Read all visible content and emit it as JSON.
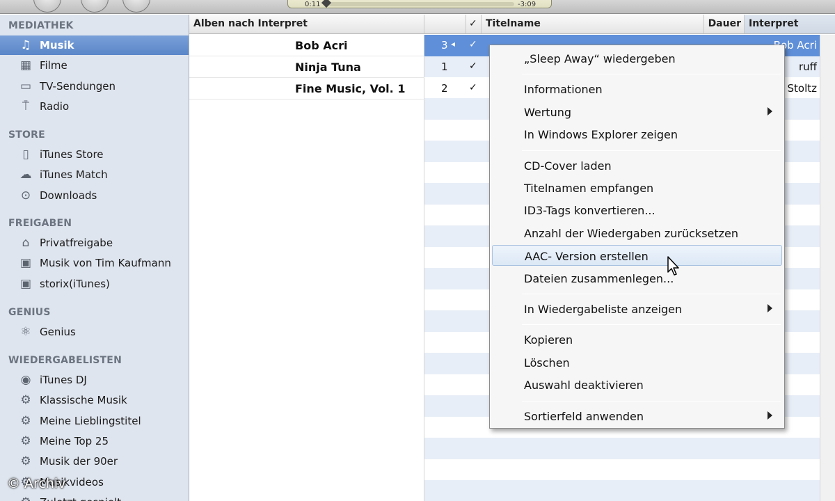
{
  "toolbar": {
    "elapsed": "0:11",
    "remaining": "-3:09"
  },
  "sidebar": {
    "sections": [
      {
        "title": "MEDIATHEK",
        "items": [
          {
            "label": "Musik",
            "icon": "music-note-icon",
            "selected": true
          },
          {
            "label": "Filme",
            "icon": "film-icon"
          },
          {
            "label": "TV-Sendungen",
            "icon": "tv-icon"
          },
          {
            "label": "Radio",
            "icon": "radio-antenna-icon"
          }
        ]
      },
      {
        "title": "STORE",
        "items": [
          {
            "label": "iTunes Store",
            "icon": "shopping-bag-icon"
          },
          {
            "label": "iTunes Match",
            "icon": "cloud-icon"
          },
          {
            "label": "Downloads",
            "icon": "download-icon"
          }
        ]
      },
      {
        "title": "FREIGABEN",
        "items": [
          {
            "label": "Privatfreigabe",
            "icon": "home-icon"
          },
          {
            "label": "Musik von Tim Kaufmann",
            "icon": "shared-library-icon"
          },
          {
            "label": "storix(iTunes)",
            "icon": "shared-library-icon"
          }
        ]
      },
      {
        "title": "GENIUS",
        "items": [
          {
            "label": "Genius",
            "icon": "genius-atom-icon"
          }
        ]
      },
      {
        "title": "WIEDERGABELISTEN",
        "items": [
          {
            "label": "iTunes DJ",
            "icon": "dj-icon"
          },
          {
            "label": "Klassische Musik",
            "icon": "smart-playlist-gear-icon"
          },
          {
            "label": "Meine Lieblingstitel",
            "icon": "smart-playlist-gear-icon"
          },
          {
            "label": "Meine Top 25",
            "icon": "smart-playlist-gear-icon"
          },
          {
            "label": "Musik der 90er",
            "icon": "smart-playlist-gear-icon"
          },
          {
            "label": "Musikvideos",
            "icon": "smart-playlist-gear-icon"
          },
          {
            "label": "Zuletzt gespielt",
            "icon": "smart-playlist-gear-icon"
          }
        ]
      }
    ]
  },
  "watermark": "© Archiv",
  "table": {
    "headers": {
      "album_by_artist": "Alben nach Interpret",
      "check": "✓",
      "title": "Titelname",
      "duration": "Dauer",
      "artist": "Interpret"
    },
    "albums": [
      "Bob Acri",
      "Ninja Tuna",
      "Fine Music, Vol. 1"
    ],
    "tracks": [
      {
        "num": "3",
        "checked": "✓",
        "artist": "Bob Acri",
        "selected": true,
        "playing": true
      },
      {
        "num": "1",
        "checked": "✓",
        "artist": "ruff"
      },
      {
        "num": "2",
        "checked": "✓",
        "artist": "d Stoltz"
      }
    ]
  },
  "context_menu": {
    "groups": [
      [
        {
          "label": "„Sleep Away“ wiedergeben"
        }
      ],
      [
        {
          "label": "Informationen"
        },
        {
          "label": "Wertung",
          "submenu": true
        },
        {
          "label": "In Windows Explorer zeigen"
        }
      ],
      [
        {
          "label": "CD-Cover laden"
        },
        {
          "label": "Titelnamen empfangen"
        },
        {
          "label": "ID3-Tags konvertieren..."
        },
        {
          "label": "Anzahl der Wiedergaben zurücksetzen"
        },
        {
          "label": "AAC- Version erstellen",
          "hover": true
        },
        {
          "label": "Dateien zusammenlegen..."
        }
      ],
      [
        {
          "label": "In Wiedergabeliste anzeigen",
          "submenu": true
        }
      ],
      [
        {
          "label": "Kopieren"
        },
        {
          "label": "Löschen"
        },
        {
          "label": "Auswahl deaktivieren"
        }
      ],
      [
        {
          "label": "Sortierfeld anwenden",
          "submenu": true
        }
      ]
    ]
  },
  "colors": {
    "sidebar_bg": "#dfe5ee",
    "selection": "#5f8fd8",
    "menu_bg": "#f6f6f6"
  }
}
